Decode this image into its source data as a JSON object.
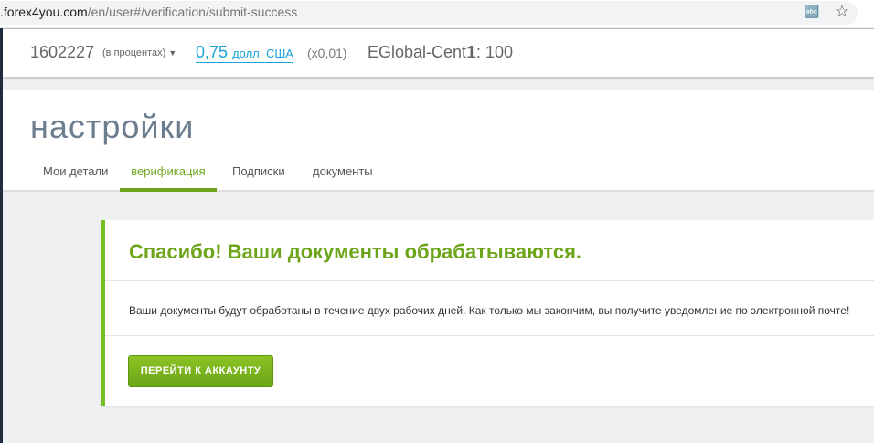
{
  "browser": {
    "url_domain": ".forex4you.com",
    "url_path": "/en/user#/verification/submit-success",
    "translate_icon": "translate-icon",
    "bookmark_icon": "star-icon"
  },
  "account": {
    "number": "1602227",
    "mode": "(в процентах)",
    "balance": "0,75",
    "currency": "долл. США",
    "multiplier": "(x0,01)",
    "server": "EGlobal-Cent1",
    "leverage": "1: 100"
  },
  "page": {
    "title": "настройки",
    "tabs": [
      {
        "label": "Мои детали"
      },
      {
        "label": "верификация",
        "active": true
      },
      {
        "label": "Подписки"
      },
      {
        "label": "документы"
      }
    ]
  },
  "card": {
    "title": "Спасибо! Ваши документы обрабатываются.",
    "text": "Ваши документы будут обработаны в течение двух рабочих дней. Как только мы закончим, вы получите уведомление по электронной почте!",
    "button": "ПЕРЕЙТИ К АККАУНТУ"
  },
  "colors": {
    "accent_green": "#6da51a",
    "link_blue": "#1aa3d9"
  }
}
